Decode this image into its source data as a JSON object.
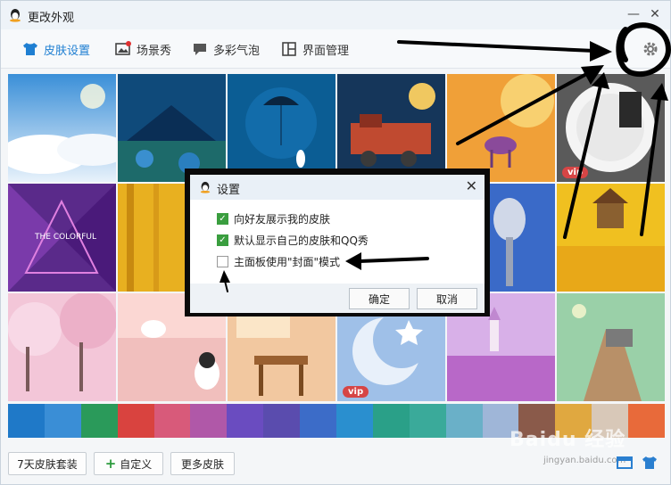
{
  "window": {
    "title": "更改外观",
    "minimize": "—",
    "close": "✕"
  },
  "tabs": [
    {
      "label": "皮肤设置",
      "icon": "shirt-icon",
      "active": true
    },
    {
      "label": "场景秀",
      "icon": "image-icon",
      "active": false
    },
    {
      "label": "多彩气泡",
      "icon": "chat-bubble-icon",
      "active": false
    },
    {
      "label": "界面管理",
      "icon": "layout-icon",
      "active": false
    }
  ],
  "skins": {
    "vip_label": "vip",
    "colorful_text": "THE COLORFUL"
  },
  "colors": [
    "#1f79c8",
    "#3a8ed6",
    "#2a9a5a",
    "#d9433f",
    "#d85a7a",
    "#b058a8",
    "#6a4cc0",
    "#5a4cae",
    "#3c6cc8",
    "#2a8fcf",
    "#2aa088",
    "#3aaa9a",
    "#6ab0c8",
    "#9fb6d8",
    "#8a5a4a",
    "#e0a840",
    "#d8c8b8",
    "#e86a3a"
  ],
  "bottom": {
    "trial_label": "7天皮肤套装",
    "custom_label": "自定义",
    "more_label": "更多皮肤"
  },
  "watermark": {
    "brand": "Baidu 经验",
    "url": "jingyan.baidu.com"
  },
  "dialog": {
    "title": "设置",
    "close": "✕",
    "options": [
      {
        "label": "向好友展示我的皮肤",
        "checked": true
      },
      {
        "label": "默认显示自己的皮肤和QQ秀",
        "checked": true
      },
      {
        "label": "主面板使用\"封面\"模式",
        "checked": false
      }
    ],
    "ok_label": "确定",
    "cancel_label": "取消"
  },
  "accent": "#1f7fd2"
}
